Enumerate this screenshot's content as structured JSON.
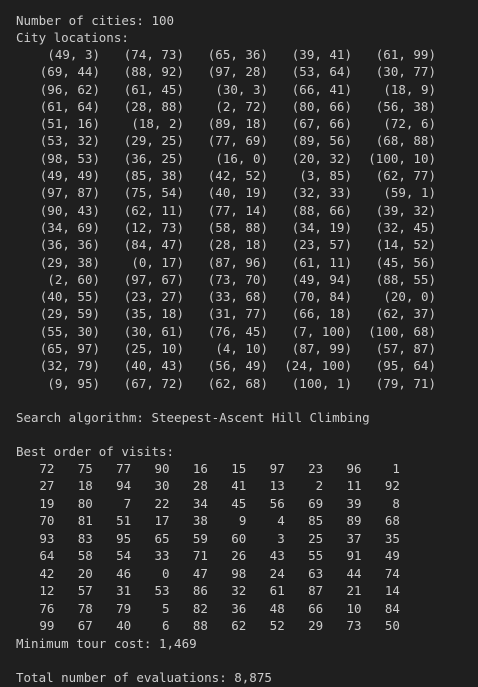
{
  "header": {
    "num_cities_line": "Number of cities: 100",
    "city_locations_label": "City locations:"
  },
  "cities": [
    "(49, 3)",
    "(74, 73)",
    "(65, 36)",
    "(39, 41)",
    "(61, 99)",
    "(69, 44)",
    "(88, 92)",
    "(97, 28)",
    "(53, 64)",
    "(30, 77)",
    "(96, 62)",
    "(61, 45)",
    "(30, 3)",
    "(66, 41)",
    "(18, 9)",
    "(61, 64)",
    "(28, 88)",
    "(2, 72)",
    "(80, 66)",
    "(56, 38)",
    "(51, 16)",
    "(18, 2)",
    "(89, 18)",
    "(67, 66)",
    "(72, 6)",
    "(53, 32)",
    "(29, 25)",
    "(77, 69)",
    "(89, 56)",
    "(68, 88)",
    "(98, 53)",
    "(36, 25)",
    "(16, 0)",
    "(20, 32)",
    "(100, 10)",
    "(49, 49)",
    "(85, 38)",
    "(42, 52)",
    "(3, 85)",
    "(62, 77)",
    "(97, 87)",
    "(75, 54)",
    "(40, 19)",
    "(32, 33)",
    "(59, 1)",
    "(90, 43)",
    "(62, 11)",
    "(77, 14)",
    "(88, 66)",
    "(39, 32)",
    "(34, 69)",
    "(12, 73)",
    "(58, 88)",
    "(34, 19)",
    "(32, 45)",
    "(36, 36)",
    "(84, 47)",
    "(28, 18)",
    "(23, 57)",
    "(14, 52)",
    "(29, 38)",
    "(0, 17)",
    "(87, 96)",
    "(61, 11)",
    "(45, 56)",
    "(2, 60)",
    "(97, 67)",
    "(73, 70)",
    "(49, 94)",
    "(88, 55)",
    "(40, 55)",
    "(23, 27)",
    "(33, 68)",
    "(70, 84)",
    "(20, 0)",
    "(29, 59)",
    "(35, 18)",
    "(31, 77)",
    "(66, 18)",
    "(62, 37)",
    "(55, 30)",
    "(30, 61)",
    "(76, 45)",
    "(7, 100)",
    "(100, 68)",
    "(65, 97)",
    "(25, 10)",
    "(4, 10)",
    "(87, 99)",
    "(57, 87)",
    "(32, 79)",
    "(40, 43)",
    "(56, 49)",
    "(24, 100)",
    "(95, 64)",
    "(9, 95)",
    "(67, 72)",
    "(62, 68)",
    "(100, 1)",
    "(79, 71)"
  ],
  "search_line": "Search algorithm: Steepest-Ascent Hill Climbing",
  "best_order_label": "Best order of visits:",
  "best_order": [
    "72",
    "75",
    "77",
    "90",
    "16",
    "15",
    "97",
    "23",
    "96",
    "1",
    "27",
    "18",
    "94",
    "30",
    "28",
    "41",
    "13",
    "2",
    "11",
    "92",
    "19",
    "80",
    "7",
    "22",
    "34",
    "45",
    "56",
    "69",
    "39",
    "8",
    "70",
    "81",
    "51",
    "17",
    "38",
    "9",
    "4",
    "85",
    "89",
    "68",
    "93",
    "83",
    "95",
    "65",
    "59",
    "60",
    "3",
    "25",
    "37",
    "35",
    "64",
    "58",
    "54",
    "33",
    "71",
    "26",
    "43",
    "55",
    "91",
    "49",
    "42",
    "20",
    "46",
    "0",
    "47",
    "98",
    "24",
    "63",
    "44",
    "74",
    "12",
    "57",
    "31",
    "53",
    "86",
    "32",
    "61",
    "87",
    "21",
    "14",
    "76",
    "78",
    "79",
    "5",
    "82",
    "36",
    "48",
    "66",
    "10",
    "84",
    "99",
    "67",
    "40",
    "6",
    "88",
    "62",
    "52",
    "29",
    "73",
    "50"
  ],
  "min_cost_line": "Minimum tour cost: 1,469",
  "evaluations_line": "Total number of evaluations: 8,875"
}
